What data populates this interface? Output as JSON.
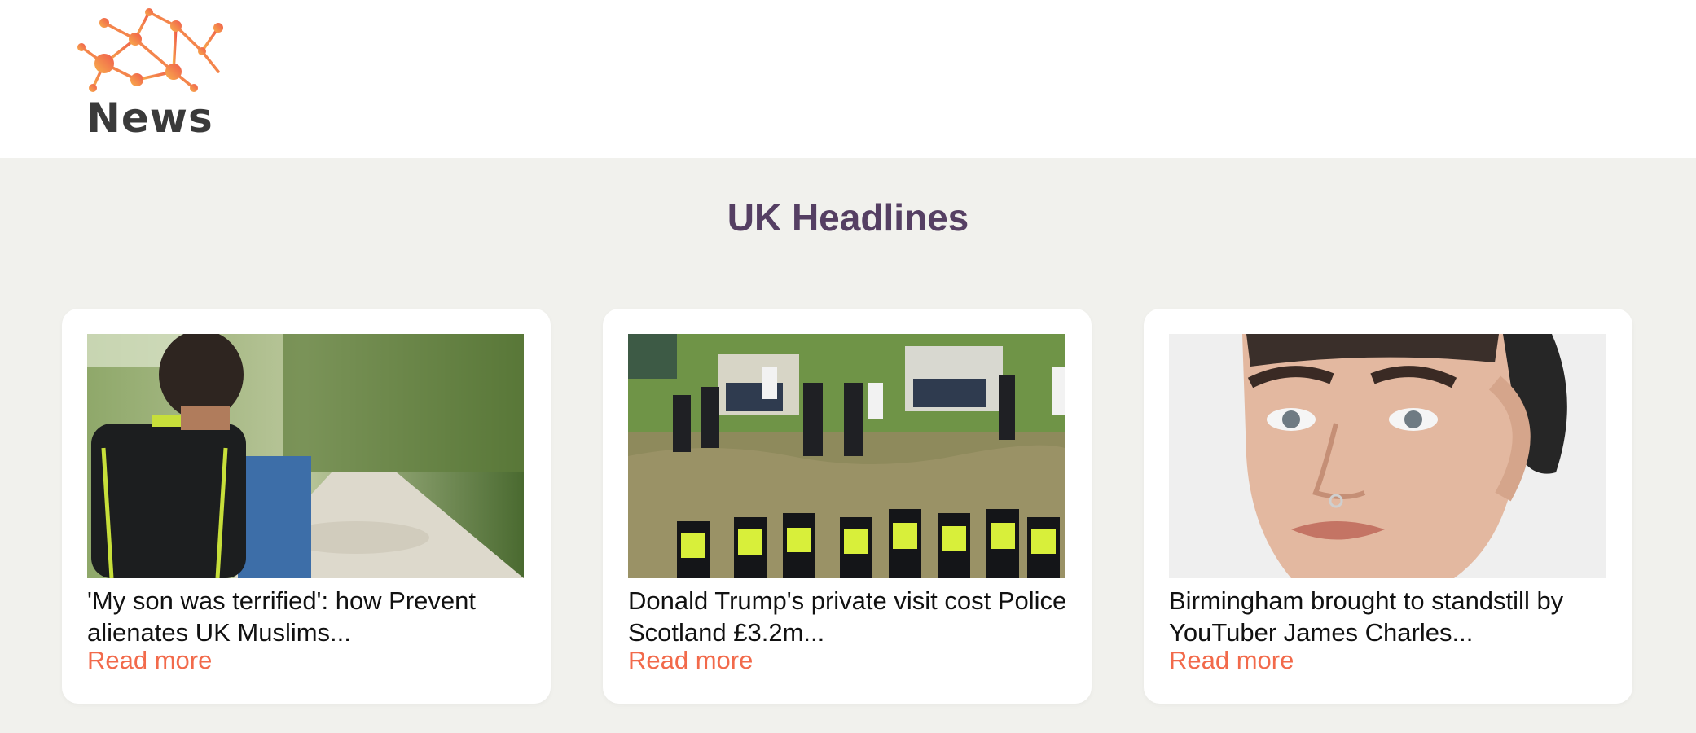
{
  "header": {
    "logo_text": "News"
  },
  "section": {
    "title": "UK Headlines"
  },
  "articles": [
    {
      "title": "'My son was terrified': how Prevent alienates UK Muslims...",
      "link_label": "Read more"
    },
    {
      "title": "Donald Trump's private visit cost Police Scotland £3.2m...",
      "link_label": "Read more"
    },
    {
      "title": "Birmingham brought to standstill by YouTuber James Charles...",
      "link_label": "Read more"
    }
  ],
  "colors": {
    "background": "#f1f1ed",
    "title": "#553f63",
    "link": "#f26a4b",
    "logo_orange": "#f7a04a",
    "logo_red": "#f0614f"
  }
}
